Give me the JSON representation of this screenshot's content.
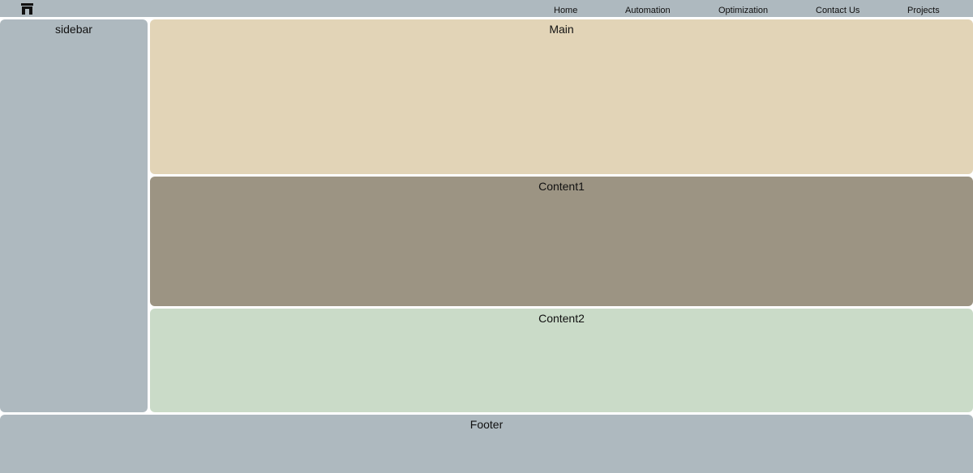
{
  "colors": {
    "navbar": "#aeb9bf",
    "sidebar": "#aeb9bf",
    "main": "#e2d4b7",
    "content1": "#9c9483",
    "content2": "#cadbc8",
    "footer": "#aeb9bf"
  },
  "header": {
    "logo_icon": "arch-logo-icon",
    "nav": [
      {
        "label": "Home"
      },
      {
        "label": "Automation"
      },
      {
        "label": "Optimization"
      },
      {
        "label": "Contact Us"
      },
      {
        "label": "Projects"
      }
    ]
  },
  "sidebar": {
    "label": "sidebar"
  },
  "main": {
    "label": "Main"
  },
  "content1": {
    "label": "Content1"
  },
  "content2": {
    "label": "Content2"
  },
  "footer": {
    "label": "Footer"
  }
}
